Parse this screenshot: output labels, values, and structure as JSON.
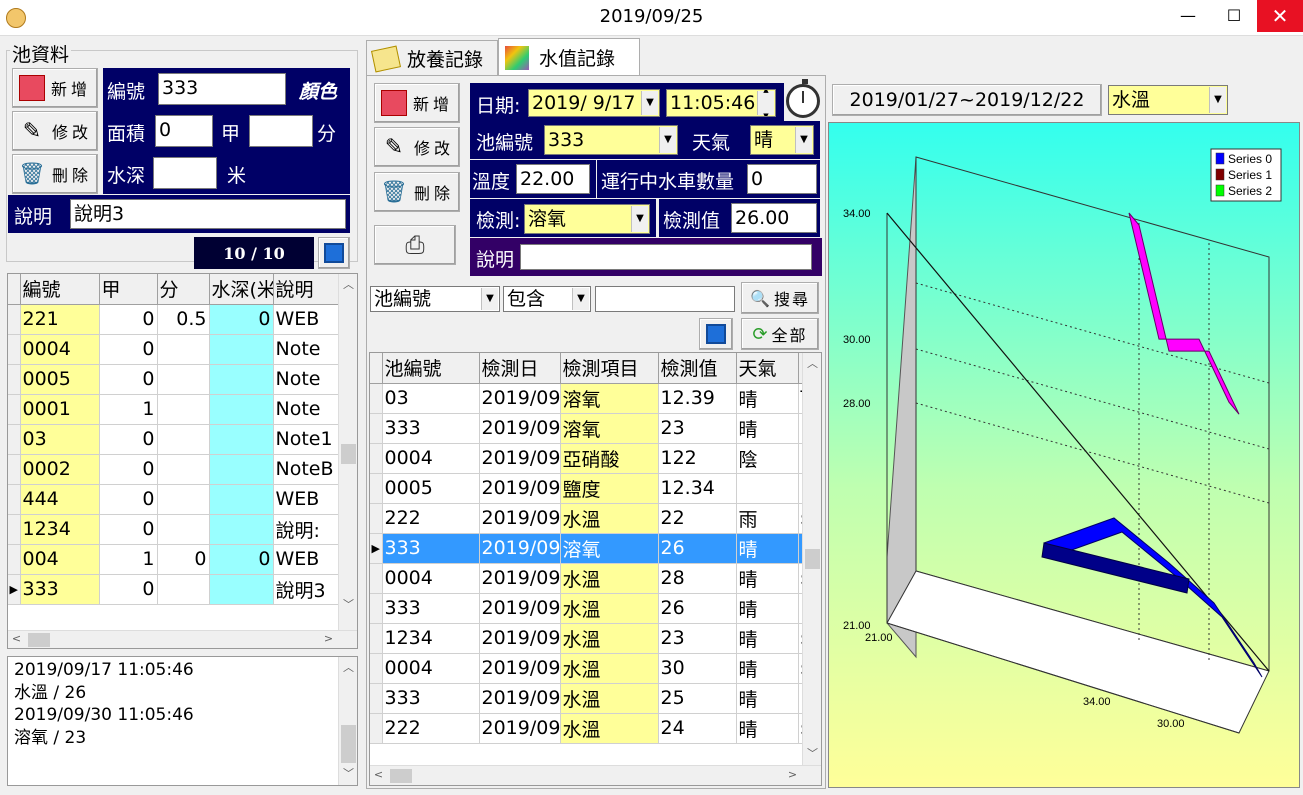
{
  "window": {
    "title": "2019/09/25"
  },
  "pool_panel": {
    "group_label": "池資料",
    "buttons": {
      "add": "新增",
      "edit": "修改",
      "delete": "刪除"
    },
    "fields": {
      "id_label": "編號",
      "id_value": "333",
      "color_label": "顏色",
      "area_label": "面積",
      "area_value": "0",
      "jia_label": "甲",
      "jia_value": "",
      "fen_label": "分",
      "depth_label": "水深",
      "depth_value": "",
      "meter_label": "米",
      "note_label": "說明",
      "note_value": "說明3"
    },
    "record_counter": "10 / 10",
    "grid": {
      "columns": [
        "編號",
        "甲",
        "分",
        "水深(米",
        "說明"
      ],
      "rows": [
        {
          "id": "221",
          "jia": "0",
          "fen": "0.5",
          "depth": "0",
          "note": "WEB"
        },
        {
          "id": "0004",
          "jia": "0",
          "fen": "",
          "depth": "",
          "note": "Note"
        },
        {
          "id": "0005",
          "jia": "0",
          "fen": "",
          "depth": "",
          "note": "Note"
        },
        {
          "id": "0001",
          "jia": "1",
          "fen": "",
          "depth": "",
          "note": "Note"
        },
        {
          "id": "03",
          "jia": "0",
          "fen": "",
          "depth": "",
          "note": "Note1"
        },
        {
          "id": "0002",
          "jia": "0",
          "fen": "",
          "depth": "",
          "note": "NoteB"
        },
        {
          "id": "444",
          "jia": "0",
          "fen": "",
          "depth": "",
          "note": "WEB"
        },
        {
          "id": "1234",
          "jia": "0",
          "fen": "",
          "depth": "",
          "note": "說明:"
        },
        {
          "id": "004",
          "jia": "1",
          "fen": "0",
          "depth": "0",
          "note": "WEB"
        },
        {
          "id": "333",
          "jia": "0",
          "fen": "",
          "depth": "",
          "note": "說明3"
        }
      ]
    },
    "log_lines": [
      "2019/09/17 11:05:46",
      "水溫 / 26",
      "2019/09/30 11:05:46",
      "溶氧 / 23"
    ]
  },
  "tabs": [
    {
      "label": "放養記錄",
      "active": false
    },
    {
      "label": "水值記錄",
      "active": true
    }
  ],
  "water_panel": {
    "buttons": {
      "add": "新增",
      "edit": "修改",
      "delete": "刪除"
    },
    "date_label": "日期:",
    "date_value": "2019/ 9/17",
    "time_value": "11:05:46",
    "pool_id_label": "池編號",
    "pool_id_value": "333",
    "weather_label": "天氣",
    "weather_value": "晴",
    "temp_label": "溫度",
    "temp_value": "22.00",
    "wheel_label": "運行中水車數量",
    "wheel_value": "0",
    "test_label": "檢測:",
    "test_value": "溶氧",
    "test_value_label": "檢測值",
    "test_value_value": "26.00",
    "note_label": "說明",
    "note_value": ""
  },
  "search": {
    "field": "池編號",
    "op": "包含",
    "text": "",
    "search_button": "搜尋",
    "all_button": "全部"
  },
  "records_grid": {
    "columns": [
      "池編號",
      "檢測日",
      "檢測項目",
      "檢測值",
      "天氣",
      ""
    ],
    "rows": [
      {
        "pool": "03",
        "date": "2019/09",
        "item": "溶氧",
        "value": "12.39",
        "weather": "晴",
        "extra": "T"
      },
      {
        "pool": "333",
        "date": "2019/09",
        "item": "溶氧",
        "value": "23",
        "weather": "晴",
        "extra": ""
      },
      {
        "pool": "0004",
        "date": "2019/09",
        "item": "亞硝酸",
        "value": "122",
        "weather": "陰",
        "extra": "I"
      },
      {
        "pool": "0005",
        "date": "2019/09",
        "item": "鹽度",
        "value": "12.34",
        "weather": "",
        "extra": "I"
      },
      {
        "pool": "222",
        "date": "2019/09",
        "item": "水溫",
        "value": "22",
        "weather": "雨",
        "extra": "s"
      },
      {
        "pool": "333",
        "date": "2019/09",
        "item": "溶氧",
        "value": "26",
        "weather": "晴",
        "extra": ""
      },
      {
        "pool": "0004",
        "date": "2019/09",
        "item": "水溫",
        "value": "28",
        "weather": "晴",
        "extra": "s"
      },
      {
        "pool": "333",
        "date": "2019/09",
        "item": "水溫",
        "value": "26",
        "weather": "晴",
        "extra": ""
      },
      {
        "pool": "1234",
        "date": "2019/09",
        "item": "水溫",
        "value": "23",
        "weather": "晴",
        "extra": "s"
      },
      {
        "pool": "0004",
        "date": "2019/09",
        "item": "水溫",
        "value": "30",
        "weather": "晴",
        "extra": "s"
      },
      {
        "pool": "333",
        "date": "2019/09",
        "item": "水溫",
        "value": "25",
        "weather": "晴",
        "extra": ""
      },
      {
        "pool": "222",
        "date": "2019/09",
        "item": "水溫",
        "value": "24",
        "weather": "晴",
        "extra": "s"
      }
    ]
  },
  "chart_panel": {
    "range": "2019/01/27~2019/12/22",
    "metric": "水溫"
  },
  "chart_data": {
    "type": "line",
    "title": "",
    "legend_position": "top-right",
    "y_ticks": [
      "34.00",
      "30.00",
      "28.00",
      "21.00"
    ],
    "x_ticks": [
      "21.00",
      "34.00",
      "30.00"
    ],
    "series": [
      {
        "name": "Series 0",
        "color": "#0000ff",
        "values": [
          21,
          23,
          22,
          25,
          28
        ]
      },
      {
        "name": "Series 1",
        "color": "#800000",
        "values": []
      },
      {
        "name": "Series 2",
        "color": "#00ff00",
        "values": []
      }
    ],
    "extra_series_color": "#ff00ff",
    "extra_series_values": [
      34,
      30,
      30,
      28
    ]
  }
}
